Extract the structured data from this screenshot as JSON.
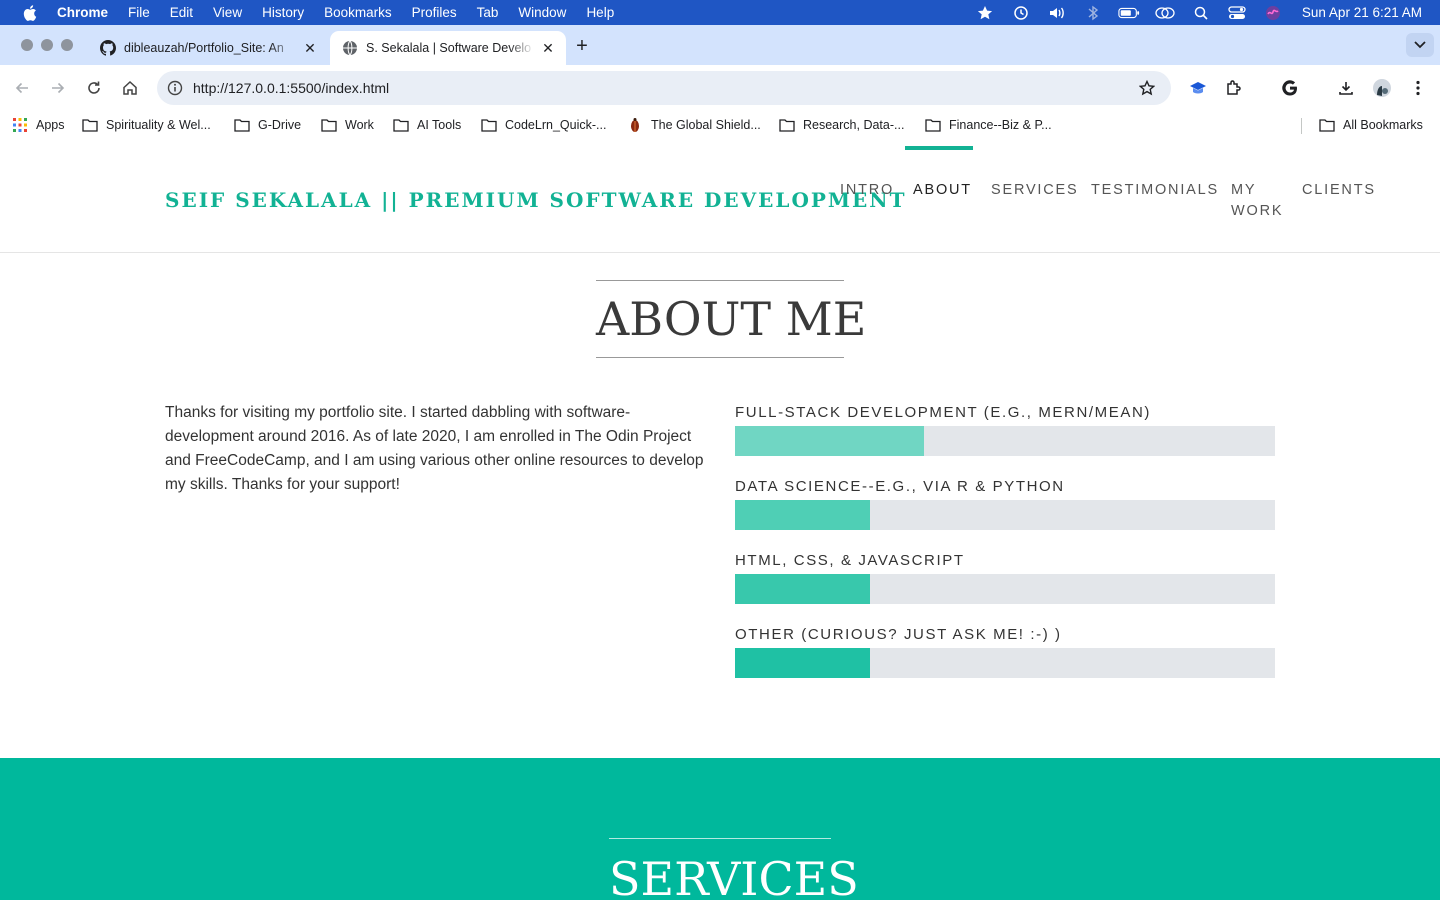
{
  "menubar": {
    "app_name": "Chrome",
    "items": [
      "File",
      "Edit",
      "View",
      "History",
      "Bookmarks",
      "Profiles",
      "Tab",
      "Window",
      "Help"
    ],
    "clock": "Sun Apr 21  6:21 AM",
    "bg_color": "#1f56c4"
  },
  "tabs": [
    {
      "title": "dibleauzah/Portfolio_Site: An",
      "favicon": "github-icon",
      "active": false
    },
    {
      "title": "S. Sekalala | Software Develo",
      "favicon": "globe-icon",
      "active": true
    }
  ],
  "toolbar": {
    "url": "http://127.0.0.1:5500/index.html"
  },
  "bookmarks": {
    "items": [
      {
        "label": "Apps",
        "icon": "apps-grid-icon"
      },
      {
        "label": "Spirituality & Wel...",
        "icon": "folder-icon"
      },
      {
        "label": "G-Drive",
        "icon": "folder-icon"
      },
      {
        "label": "Work",
        "icon": "folder-icon"
      },
      {
        "label": "AI Tools",
        "icon": "folder-icon"
      },
      {
        "label": "CodeLrn_Quick-...",
        "icon": "folder-icon"
      },
      {
        "label": "The Global Shield...",
        "icon": "bug-icon"
      },
      {
        "label": "Research, Data-...",
        "icon": "folder-icon"
      },
      {
        "label": "Finance--Biz & P...",
        "icon": "folder-icon"
      }
    ],
    "all_bookmarks": "All Bookmarks"
  },
  "site": {
    "brand": "SEIF SEKALALA || PREMIUM SOFTWARE DEVELOPMENT",
    "accent_color": "#12b294",
    "nav": [
      {
        "label": "INTRO",
        "active": false
      },
      {
        "label": "ABOUT",
        "active": true
      },
      {
        "label": "SERVICES",
        "active": false
      },
      {
        "label": "TESTIMONIALS",
        "active": false
      },
      {
        "label": "MY WORK",
        "active": false
      },
      {
        "label": "CLIENTS",
        "active": false
      }
    ]
  },
  "about": {
    "title": "ABOUT ME",
    "text": "Thanks for visiting my portfolio site. I started dabbling with software-development around 2016. As of late 2020, I am enrolled in The Odin Project and FreeCodeCamp, and I am using various other online resources to develop my skills. Thanks for your support!",
    "skills": [
      {
        "label": "FULL-STACK DEVELOPMENT (E.G., MERN/MEAN)",
        "percent": 35,
        "color": "#70d6c3"
      },
      {
        "label": "DATA SCIENCE--E.G., VIA R & PYTHON",
        "percent": 25,
        "color": "#4fcfb5"
      },
      {
        "label": "HTML, CSS, & JAVASCRIPT",
        "percent": 25,
        "color": "#38c8ac"
      },
      {
        "label": "OTHER (CURIOUS? JUST ASK ME! :-) )",
        "percent": 25,
        "color": "#1fc1a4"
      }
    ]
  },
  "services": {
    "title": "SERVICES",
    "bg_color": "#00b89c"
  }
}
